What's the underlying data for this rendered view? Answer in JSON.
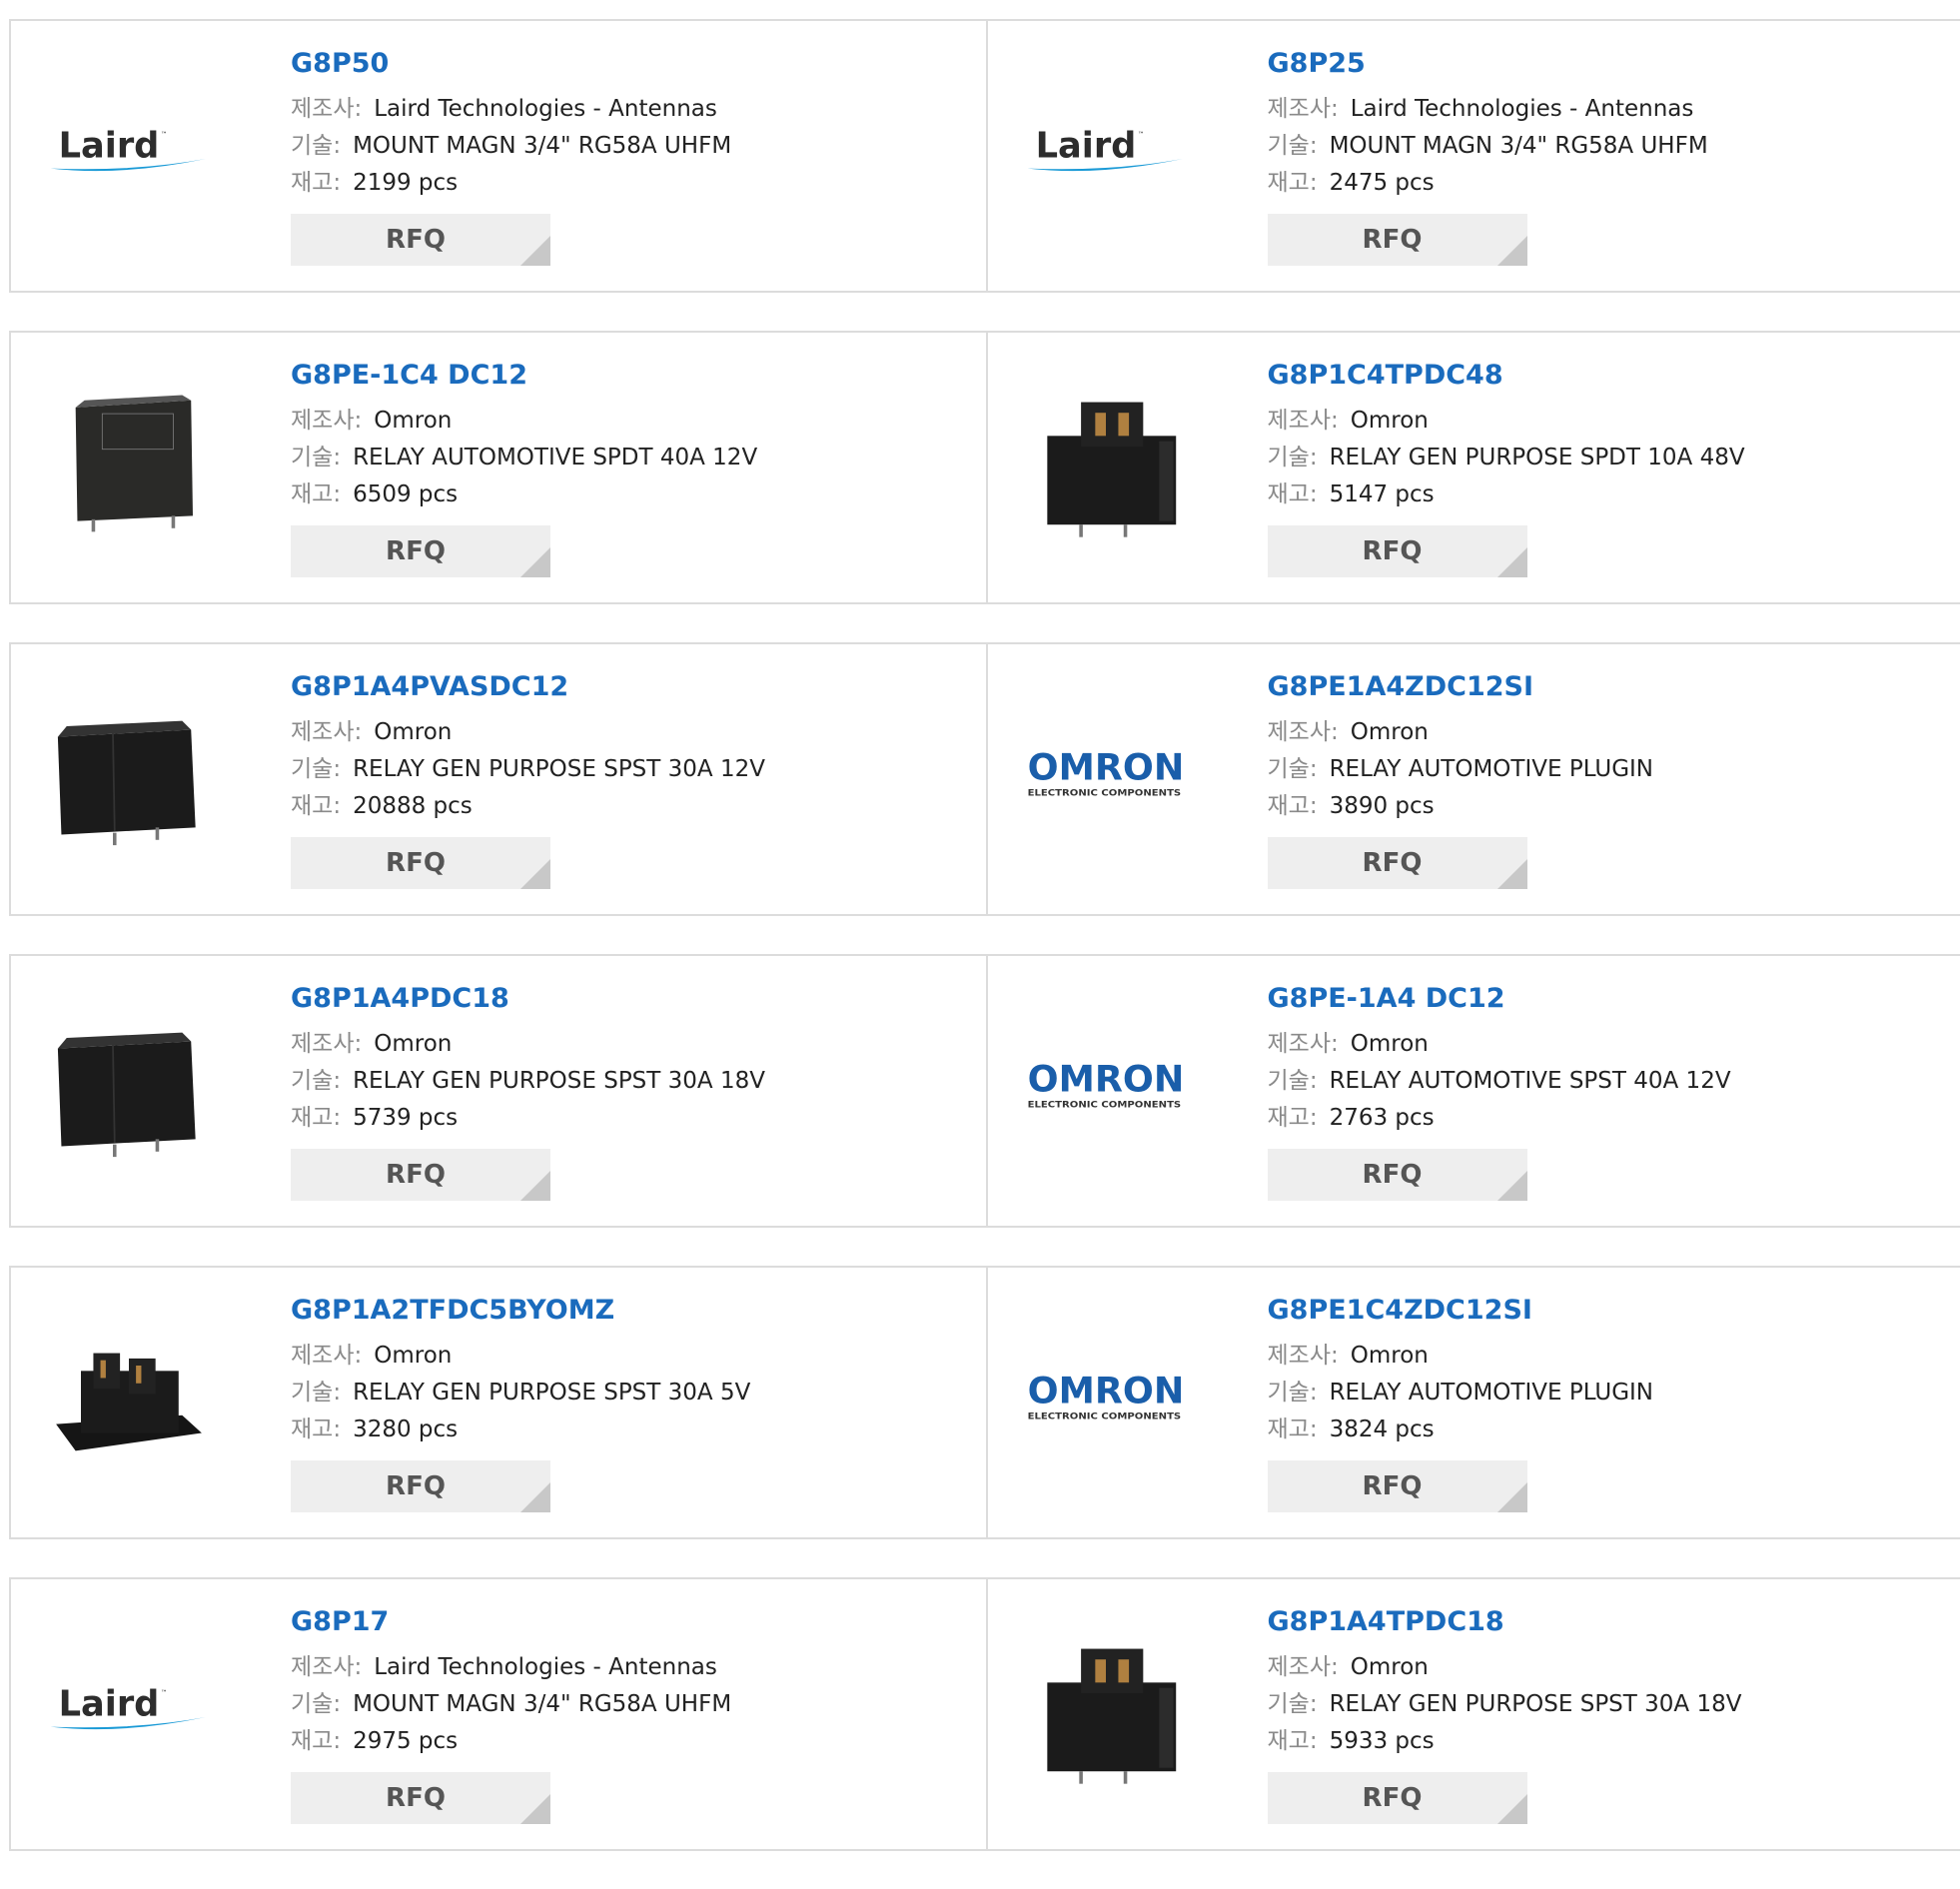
{
  "labels": {
    "manufacturer": "제조사:",
    "description": "기술:",
    "stock": "재고:"
  },
  "rfq_label": "RFQ",
  "logos": {
    "laird_word": "Laird",
    "omron_word": "OMRON",
    "omron_sub": "ELECTRONIC COMPONENTS"
  },
  "colors": {
    "part_number": "#1a6bbd",
    "laird_text": "#2d2d2d",
    "laird_swoosh": "#1a9ad6",
    "omron_blue": "#1a5eaa",
    "relay_body": "#1b1b1b"
  },
  "products": [
    {
      "part": "G8P50",
      "manufacturer": "Laird Technologies - Antennas",
      "description": "MOUNT MAGN 3/4\" RG58A UHFM",
      "stock": "2199 pcs",
      "image": "laird-logo"
    },
    {
      "part": "G8P25",
      "manufacturer": "Laird Technologies - Antennas",
      "description": "MOUNT MAGN 3/4\" RG58A UHFM",
      "stock": "2475 pcs",
      "image": "laird-logo"
    },
    {
      "part": "G8PE-1C4 DC12",
      "manufacturer": "Omron",
      "description": "RELAY AUTOMOTIVE SPDT 40A 12V",
      "stock": "6509 pcs",
      "image": "relay-box-photo"
    },
    {
      "part": "G8P1C4TPDC48",
      "manufacturer": "Omron",
      "description": "RELAY GEN PURPOSE SPDT 10A 48V",
      "stock": "5147 pcs",
      "image": "relay-tall-photo"
    },
    {
      "part": "G8P1A4PVASDC12",
      "manufacturer": "Omron",
      "description": "RELAY GEN PURPOSE SPST 30A 12V",
      "stock": "20888 pcs",
      "image": "relay-wide-photo"
    },
    {
      "part": "G8PE1A4ZDC12SI",
      "manufacturer": "Omron",
      "description": "RELAY AUTOMOTIVE PLUGIN",
      "stock": "3890 pcs",
      "image": "omron-logo"
    },
    {
      "part": "G8P1A4PDC18",
      "manufacturer": "Omron",
      "description": "RELAY GEN PURPOSE SPST 30A 18V",
      "stock": "5739 pcs",
      "image": "relay-wide-photo"
    },
    {
      "part": "G8PE-1A4 DC12",
      "manufacturer": "Omron",
      "description": "RELAY AUTOMOTIVE SPST 40A 12V",
      "stock": "2763 pcs",
      "image": "omron-logo"
    },
    {
      "part": "G8P1A2TFDC5BYOMZ",
      "manufacturer": "Omron",
      "description": "RELAY GEN PURPOSE SPST 30A 5V",
      "stock": "3280 pcs",
      "image": "relay-flange-photo"
    },
    {
      "part": "G8PE1C4ZDC12SI",
      "manufacturer": "Omron",
      "description": "RELAY AUTOMOTIVE PLUGIN",
      "stock": "3824 pcs",
      "image": "omron-logo"
    },
    {
      "part": "G8P17",
      "manufacturer": "Laird Technologies - Antennas",
      "description": "MOUNT MAGN 3/4\" RG58A UHFM",
      "stock": "2975 pcs",
      "image": "laird-logo"
    },
    {
      "part": "G8P1A4TPDC18",
      "manufacturer": "Omron",
      "description": "RELAY GEN PURPOSE SPST 30A 18V",
      "stock": "5933 pcs",
      "image": "relay-tall-photo"
    }
  ]
}
